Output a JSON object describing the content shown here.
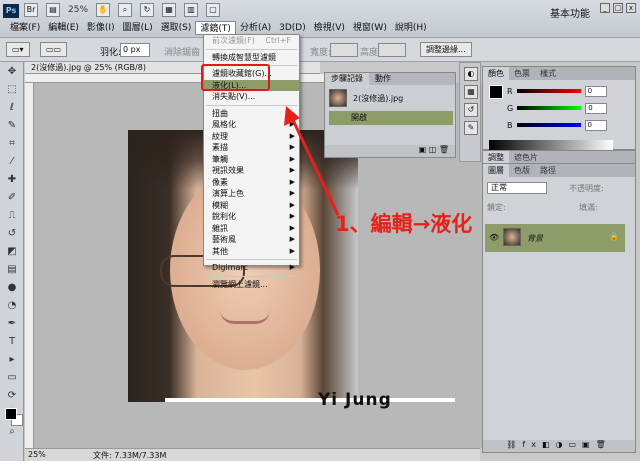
{
  "app": {
    "logo": "Ps",
    "zoom": "25%",
    "workspace": "基本功能"
  },
  "menubar": {
    "items": [
      "檔案(F)",
      "編輯(E)",
      "影像(I)",
      "圖層(L)",
      "選取(S)",
      "濾鏡(T)",
      "分析(A)",
      "3D(D)",
      "檢視(V)",
      "視窗(W)",
      "說明(H)"
    ]
  },
  "options": {
    "feather_label": "羽化:",
    "feather_value": "0 px",
    "antialias": "消除鋸齒",
    "width_label": "寬度:",
    "height_label": "高度:",
    "refine": "調整邊緣..."
  },
  "document": {
    "tab": "2(沒修過).jpg @ 25% (RGB/8)",
    "status_zoom": "25%",
    "status_doc": "文件: 7.33M/7.33M"
  },
  "filter_menu": {
    "top": [
      {
        "label": "前次濾鏡(F)",
        "shortcut": "Ctrl+F",
        "disabled": true
      }
    ],
    "group1": [
      "轉換成智慧型濾鏡"
    ],
    "group2": [
      "濾鏡收藏館(G)...",
      "液化(L)...",
      "消失點(V)..."
    ],
    "group3": [
      "扭曲",
      "風格化",
      "紋理",
      "素描",
      "筆觸",
      "視訊效果",
      "像素",
      "演算上色",
      "模糊",
      "銳利化",
      "雜訊",
      "藝術風",
      "其他"
    ],
    "group4": [
      "Digimarc"
    ],
    "group5": [
      "瀏覽網上濾鏡..."
    ]
  },
  "history": {
    "tabs": [
      "步驟記錄",
      "動作"
    ],
    "snapshot": "2(沒修過).jpg",
    "step": "開啟"
  },
  "color_panel": {
    "tabs": [
      "顏色",
      "色票",
      "樣式"
    ],
    "r": "0",
    "g": "0",
    "b": "0",
    "r_label": "R",
    "g_label": "G",
    "b_label": "B"
  },
  "adjust_panel": {
    "tabs": [
      "調整",
      "遮色片"
    ]
  },
  "layers_panel": {
    "tabs": [
      "圖層",
      "色版",
      "路徑"
    ],
    "mode": "正常",
    "opacity_label": "不透明度:",
    "lock_label": "鎖定:",
    "fill_label": "填滿:",
    "layer_name": "背景"
  },
  "photo": {
    "watermark": "Yi Jung"
  },
  "annotation": {
    "text": "1、編輯→液化",
    "color": "#e8201a"
  },
  "colors": {
    "highlight": "#8e9c6a",
    "annotation_red": "#e01a1a"
  }
}
